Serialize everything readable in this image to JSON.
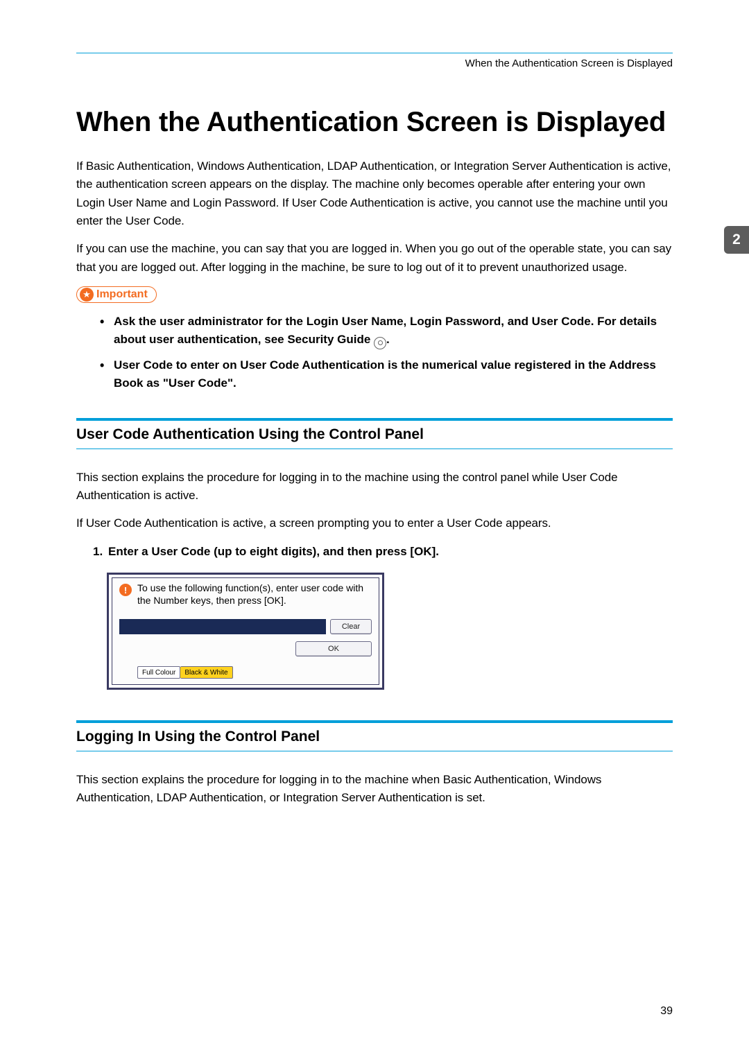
{
  "header": {
    "running_title": "When the Authentication Screen is Displayed"
  },
  "title": "When the Authentication Screen is Displayed",
  "intro_paragraphs": {
    "p1": "If Basic Authentication, Windows Authentication, LDAP Authentication, or Integration Server Authentication is active, the authentication screen appears on the display. The machine only becomes operable after entering your own Login User Name and Login Password. If User Code Authentication is active, you cannot use the machine until you enter the User Code.",
    "p2": "If you can use the machine, you can say that you are logged in. When you go out of the operable state, you can say that you are logged out. After logging in the machine, be sure to log out of it to prevent unauthorized usage."
  },
  "important": {
    "label": "Important",
    "items": {
      "i1_a": "Ask the user administrator for the Login User Name, Login Password, and User Code. For details about user authentication, see Security Guide",
      "i1_b": ".",
      "i2": "User Code to enter on User Code Authentication is the numerical value registered in the Address Book as \"User Code\"."
    }
  },
  "sections": {
    "s1": {
      "heading": "User Code Authentication Using the Control Panel",
      "p1": "This section explains the procedure for logging in to the machine using the control panel while User Code Authentication is active.",
      "p2": "If User Code Authentication is active, a screen prompting you to enter a User Code appears.",
      "step1": "Enter a User Code (up to eight digits), and then press [OK]."
    },
    "s2": {
      "heading": "Logging In Using the Control Panel",
      "p1": "This section explains the procedure for logging in to the machine when Basic Authentication, Windows Authentication, LDAP Authentication, or Integration Server Authentication is set."
    }
  },
  "panel": {
    "message": "To use the following function(s), enter user code with the Number keys, then press [OK].",
    "clear": "Clear",
    "ok": "OK",
    "full_colour": "Full Colour",
    "black_white": "Black & White"
  },
  "chapter_tab": "2",
  "page_number": "39"
}
